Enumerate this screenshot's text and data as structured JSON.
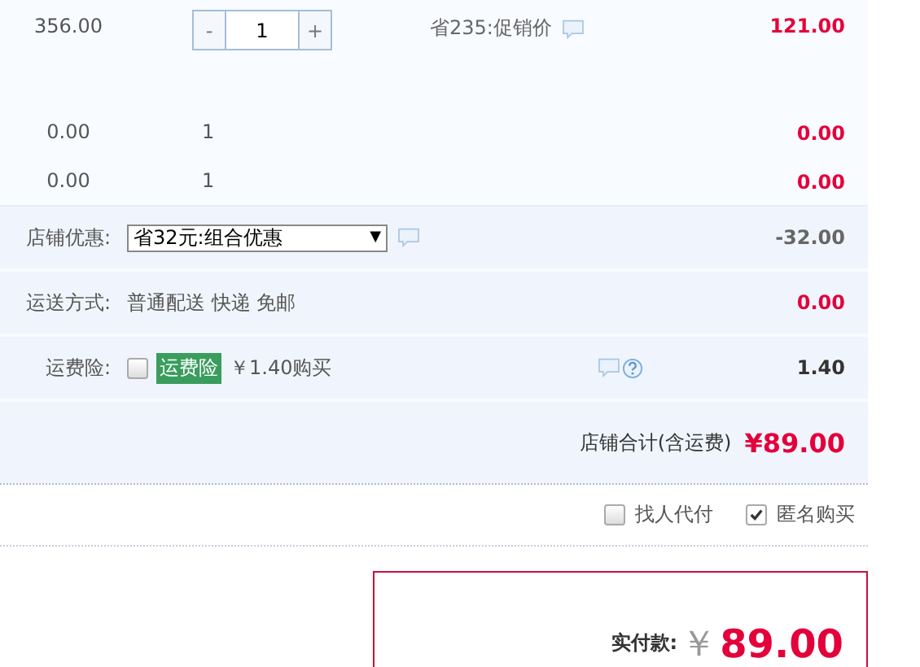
{
  "items": [
    {
      "price": "356.00",
      "quantity": "1",
      "editable": true,
      "promo": "省235:促销价",
      "total": "121.00"
    },
    {
      "price": "0.00",
      "quantity": "1",
      "editable": false,
      "total": "0.00"
    },
    {
      "price": "0.00",
      "quantity": "1",
      "editable": false,
      "total": "0.00"
    }
  ],
  "stepper": {
    "minus": "-",
    "plus": "+"
  },
  "store_discount": {
    "label": "店铺优惠:",
    "selected_option": "省32元:组合优惠",
    "arrow": "▼",
    "amount": "-32.00"
  },
  "shipping": {
    "label": "运送方式:",
    "method": "普通配送 快递 免邮",
    "amount": "0.00"
  },
  "insurance": {
    "label": "运费险:",
    "checked": false,
    "tag": "运费险",
    "offer": "￥1.40购买",
    "amount": "1.40"
  },
  "store_total": {
    "label": "店铺合计(含运费)",
    "amount": "¥89.00"
  },
  "options": [
    {
      "label": "找人代付",
      "checked": false
    },
    {
      "label": "匿名购买",
      "checked": true
    }
  ],
  "payment": {
    "label": "实付款:",
    "currency": "￥",
    "amount": "89.00"
  }
}
